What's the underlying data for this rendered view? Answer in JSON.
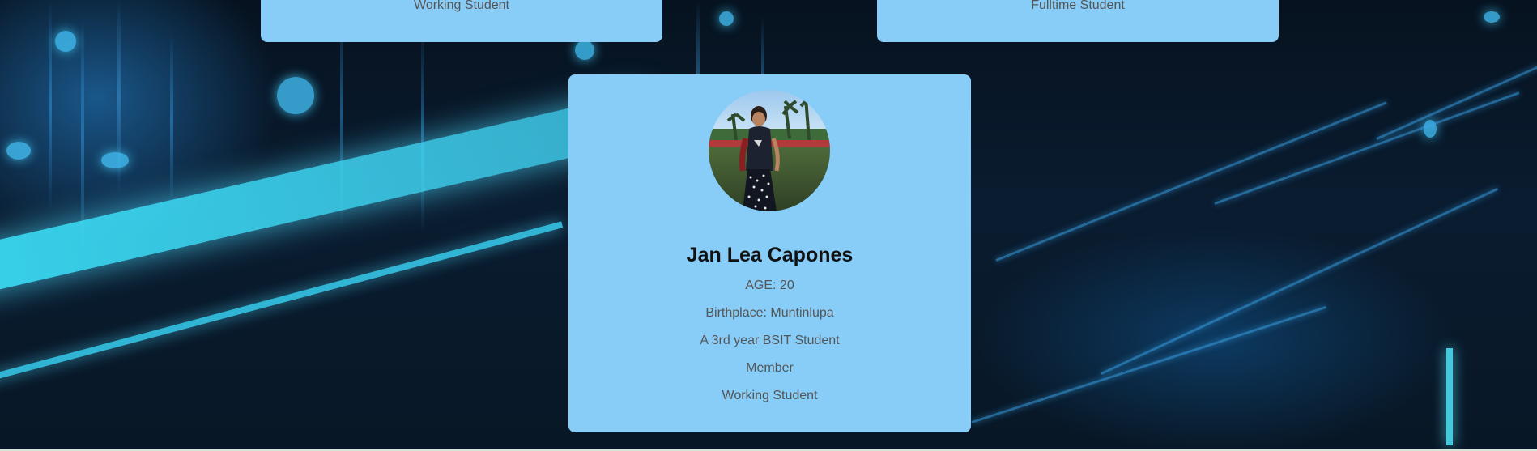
{
  "cards_partial": [
    {
      "subtitle": "Working Student"
    },
    {
      "subtitle": "Fulltime Student"
    }
  ],
  "profile": {
    "photo_icon": "profile-photo",
    "name": "Jan Lea Capones",
    "age": "AGE: 20",
    "birthplace": "Birthplace: Muntinlupa",
    "year": "A 3rd year BSIT Student",
    "role": "Member",
    "status": "Working Student"
  },
  "colors": {
    "card_background": "#87cdf8",
    "name_text": "#111111",
    "info_text": "#555555",
    "accent_glow": "#3ce6ff"
  }
}
